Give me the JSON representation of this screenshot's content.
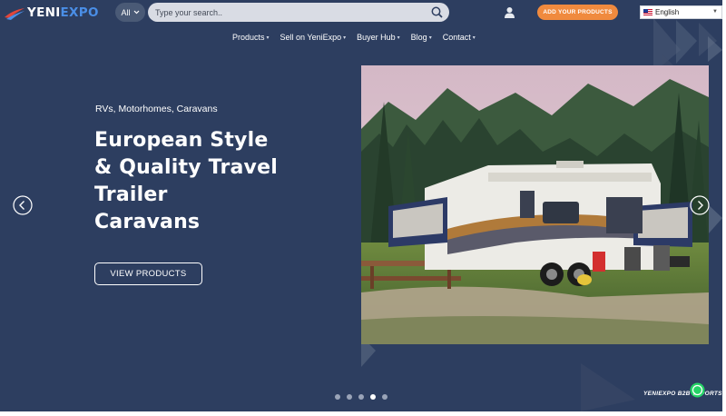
{
  "header": {
    "logo_text": {
      "part1": "YENI",
      "part2": "EXPO"
    },
    "search": {
      "category": "All",
      "placeholder": "Type your search.."
    },
    "add_products_label": "ADD YOUR PRODUCTS",
    "language": "English"
  },
  "nav": {
    "items": [
      {
        "label": "Products"
      },
      {
        "label": "Sell on YeniExpo"
      },
      {
        "label": "Buyer Hub"
      },
      {
        "label": "Blog"
      },
      {
        "label": "Contact"
      }
    ]
  },
  "hero": {
    "subtitle": "RVs, Motorhomes, Caravans",
    "title_lines": [
      "European Style",
      "& Quality Travel",
      "Trailer",
      "Caravans"
    ],
    "button_label": "VIEW PRODUCTS"
  },
  "slider": {
    "slide_count": 5,
    "active_index": 3
  },
  "footer_tag": "YENIEXPO B2B EXPORTS",
  "colors": {
    "background": "#2d3e60",
    "accent": "#f08a3e",
    "brand_blue": "#4a8ee6"
  },
  "icons": [
    "logo-swoosh",
    "chevron-down-icon",
    "search-icon",
    "user-icon",
    "flag-icon",
    "arrow-left-icon",
    "arrow-right-icon",
    "whatsapp-icon"
  ]
}
